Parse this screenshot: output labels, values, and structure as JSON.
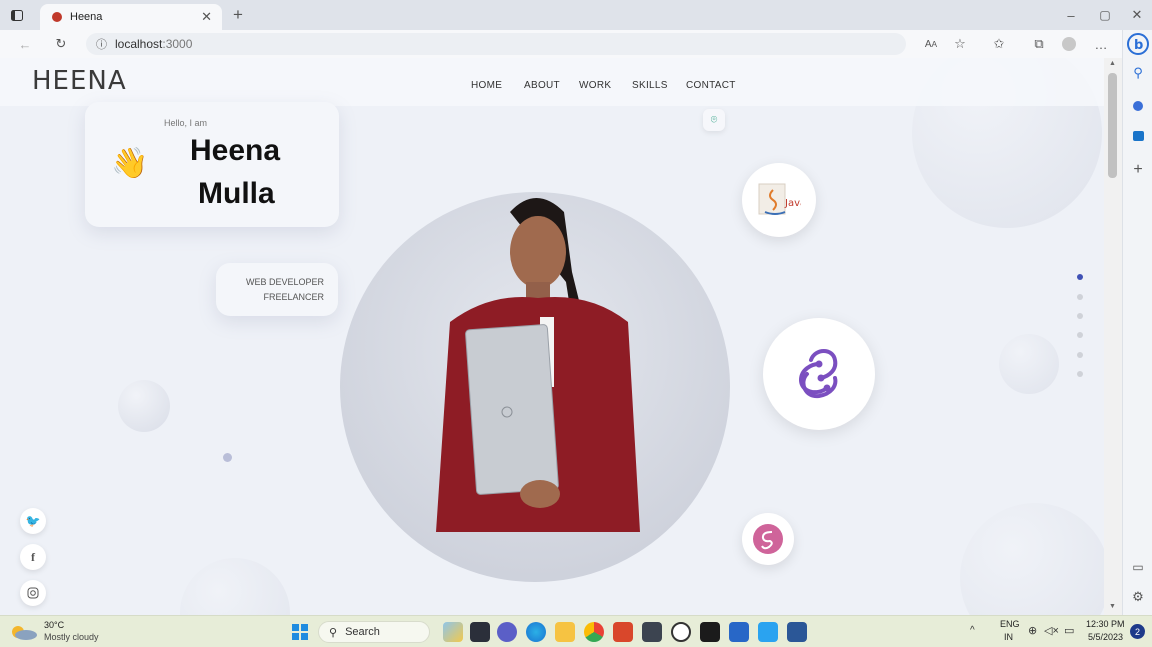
{
  "browser": {
    "tab_title": "Heena",
    "url_host": "localhost",
    "url_port": ":3000",
    "icons": [
      "tab-actions-icon",
      "favicon-icon",
      "close-tab-icon",
      "new-tab-icon",
      "back-icon",
      "refresh-icon",
      "info-icon",
      "read-aloud-icon",
      "favorite-icon",
      "favorites-icon",
      "collections-icon",
      "profile-icon",
      "more-icon",
      "bing-icon",
      "minimize-icon",
      "restore-icon",
      "close-window-icon"
    ]
  },
  "sidebar": {
    "icons": [
      "search-icon",
      "shopping-icon",
      "outlook-icon",
      "add-icon",
      "split-screen-icon",
      "settings-icon"
    ]
  },
  "site": {
    "logo": "HEENA",
    "nav": [
      "HOME",
      "ABOUT",
      "WORK",
      "SKILLS",
      "CONTACT"
    ],
    "greeting": "Hello, I am",
    "first_name": "Heena",
    "last_name": "Mulla",
    "roles": [
      "WEB DEVELOPER",
      "FREELANCER"
    ],
    "skill_icons": [
      "java-icon",
      "redux-icon",
      "sass-icon"
    ],
    "socials": [
      "twitter-icon",
      "facebook-icon",
      "instagram-icon"
    ],
    "accent": "#7b4fc0"
  },
  "taskbar": {
    "weather_temp": "30°C",
    "weather_desc": "Mostly cloudy",
    "search_label": "Search",
    "lang_top": "ENG",
    "lang_bottom": "IN",
    "time": "12:30 PM",
    "date": "5/5/2023",
    "notifications": "2"
  }
}
